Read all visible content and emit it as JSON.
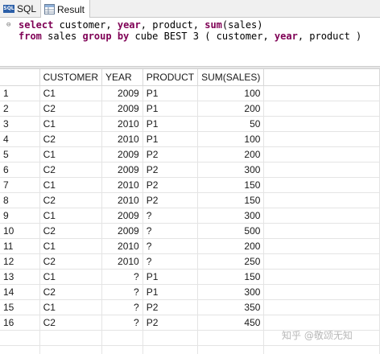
{
  "tabs": [
    {
      "label": "SQL",
      "icon": "sql-file-icon"
    },
    {
      "label": "Result",
      "icon": "result-grid-icon"
    }
  ],
  "editor": {
    "line1": [
      {
        "t": "select",
        "k": "kw"
      },
      {
        "t": " customer, ",
        "k": "plain"
      },
      {
        "t": "year",
        "k": "kw"
      },
      {
        "t": ", product, ",
        "k": "plain"
      },
      {
        "t": "sum",
        "k": "fn"
      },
      {
        "t": "(sales)",
        "k": "plain"
      }
    ],
    "line2": [
      {
        "t": "from",
        "k": "kw"
      },
      {
        "t": " sales ",
        "k": "plain"
      },
      {
        "t": "group by",
        "k": "kw"
      },
      {
        "t": " cube BEST 3 ( customer, ",
        "k": "plain"
      },
      {
        "t": "year",
        "k": "kw"
      },
      {
        "t": ", product )",
        "k": "plain"
      }
    ]
  },
  "grid": {
    "columns": [
      "CUSTOMER",
      "YEAR",
      "PRODUCT",
      "SUM(SALES)"
    ],
    "rows": [
      [
        "1",
        "C1",
        "2009",
        "P1",
        "100"
      ],
      [
        "2",
        "C2",
        "2009",
        "P1",
        "200"
      ],
      [
        "3",
        "C1",
        "2010",
        "P1",
        "50"
      ],
      [
        "4",
        "C2",
        "2010",
        "P1",
        "100"
      ],
      [
        "5",
        "C1",
        "2009",
        "P2",
        "200"
      ],
      [
        "6",
        "C2",
        "2009",
        "P2",
        "300"
      ],
      [
        "7",
        "C1",
        "2010",
        "P2",
        "150"
      ],
      [
        "8",
        "C2",
        "2010",
        "P2",
        "150"
      ],
      [
        "9",
        "C1",
        "2009",
        "?",
        "300"
      ],
      [
        "10",
        "C2",
        "2009",
        "?",
        "500"
      ],
      [
        "11",
        "C1",
        "2010",
        "?",
        "200"
      ],
      [
        "12",
        "C2",
        "2010",
        "?",
        "250"
      ],
      [
        "13",
        "C1",
        "?",
        "P1",
        "150"
      ],
      [
        "14",
        "C2",
        "?",
        "P1",
        "300"
      ],
      [
        "15",
        "C1",
        "?",
        "P2",
        "350"
      ],
      [
        "16",
        "C2",
        "?",
        "P2",
        "450"
      ]
    ],
    "empty_rows": 2
  },
  "watermark": "知乎 @敬颂无知",
  "colors": {
    "keyword": "#7f0055",
    "grid_line": "#e4e4e4",
    "tab_bar": "#f0f0f0"
  }
}
